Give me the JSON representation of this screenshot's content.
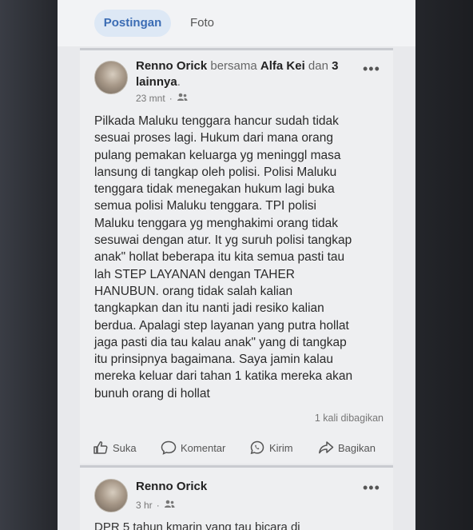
{
  "tabs": [
    {
      "label": "Postingan",
      "active": true
    },
    {
      "label": "Foto",
      "active": false
    }
  ],
  "post1": {
    "author": "Renno Orick",
    "with_word": "bersama",
    "tagged": "Alfa Kei",
    "and_word": "dan",
    "others": "3",
    "others_suffix": "lainnya",
    "time": "23 mnt",
    "body": "Pilkada Maluku tenggara  hancur sudah tidak\nsesuai proses lagi. Hukum dari mana orang\npulang pemakan keluarga yg meninggl masa\nlansung di tangkap oleh polisi. Polisi Maluku\ntenggara tidak menegakan hukum lagi buka\nsemua polisi Maluku tenggara. TPI polisi\nMaluku tenggara yg menghakimi orang tidak\nsesuwai dengan atur. It yg suruh polisi tangkap\nanak\" hollat beberapa itu kita semua pasti tau\nlah STEP LAYANAN  dengan TAHER\nHANUBUN. orang tidak salah kalian\ntangkapkan dan itu nanti jadi resiko kalian\nberdua. Apalagi step layanan yang putra hollat\njaga pasti dia tau kalau anak\" yang di tangkap\nitu prinsipnya bagaimana. Saya jamin kalau\nmereka keluar dari tahan 1 katika mereka akan\nbunuh orang di hollat",
    "share_count": "1 kali dibagikan",
    "actions": {
      "like": "Suka",
      "comment": "Komentar",
      "send": "Kirim",
      "share": "Bagikan"
    }
  },
  "post2": {
    "author": "Renno Orick",
    "time": "3 hr",
    "body_partial": "DPR 5 tahun kmarin yang tau bicara di"
  },
  "icons": {
    "audience": "friends-icon",
    "more": "more-options-icon"
  }
}
